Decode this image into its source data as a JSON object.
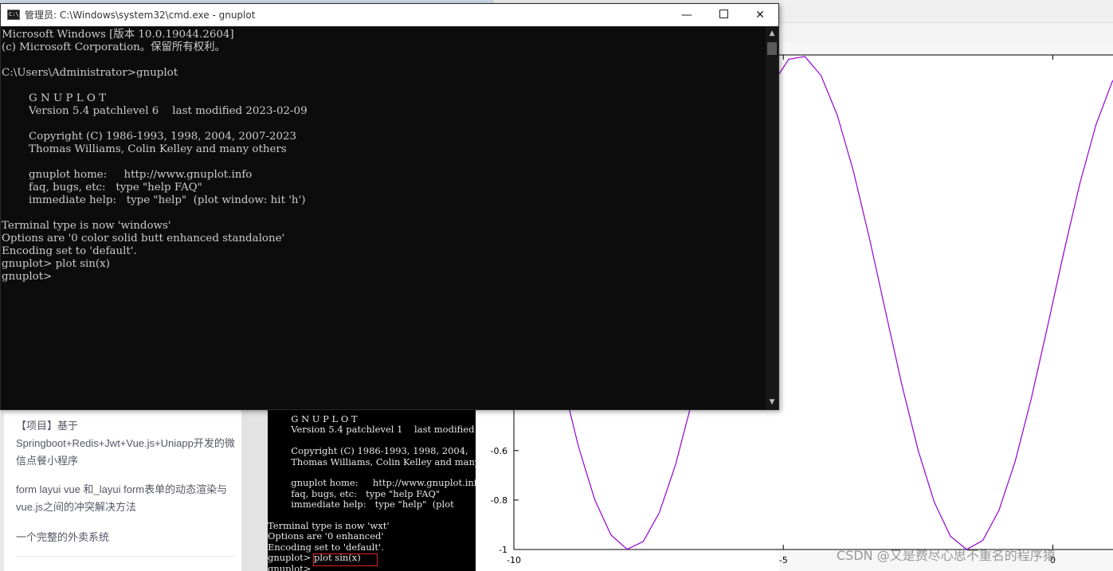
{
  "cmd_window": {
    "title": "管理员: C:\\Windows\\system32\\cmd.exe - gnuplot",
    "icon": "cmd-icon",
    "icon_text": "C:\\",
    "minimize_glyph": "—",
    "close_glyph": "✕",
    "scroll_up_glyph": "▲",
    "scroll_down_glyph": "▼",
    "console_lines": [
      "Microsoft Windows [版本 10.0.19044.2604]",
      "(c) Microsoft Corporation。保留所有权利。",
      "",
      "C:\\Users\\Administrator>gnuplot",
      "",
      "        G N U P L O T",
      "        Version 5.4 patchlevel 6    last modified 2023-02-09",
      "",
      "        Copyright (C) 1986-1993, 1998, 2004, 2007-2023",
      "        Thomas Williams, Colin Kelley and many others",
      "",
      "        gnuplot home:     http://www.gnuplot.info",
      "        faq, bugs, etc:   type \"help FAQ\"",
      "        immediate help:   type \"help\"  (plot window: hit 'h')",
      "",
      "Terminal type is now 'windows'",
      "Options are '0 color solid butt enhanced standalone'",
      "Encoding set to 'default'.",
      "gnuplot> plot sin(x)",
      "gnuplot>"
    ]
  },
  "blog_panel": {
    "items": [
      "【项目】基于Springboot+Redis+Jwt+Vue.js+Uniapp开发的微信点餐小程序",
      "form layui vue 和_layui form表单的动态渲染与vue.js之间的冲突解决方法",
      "一个完整的外卖系统"
    ]
  },
  "embedded_console": {
    "lines": [
      "        G N U P L O T",
      "        Version 5.4 patchlevel 1    last modified",
      "",
      "        Copyright (C) 1986-1993, 1998, 2004,",
      "        Thomas Williams, Colin Kelley and many",
      "",
      "        gnuplot home:     http://www.gnuplot.info",
      "        faq, bugs, etc:   type \"help FAQ\"",
      "        immediate help:   type \"help\"  (plot",
      "",
      "Terminal type is now 'wxt'",
      "Options are '0 enhanced'",
      "Encoding set to 'default'.",
      "gnuplot> plot sin(x)",
      "gnuplot>"
    ]
  },
  "chart_data": {
    "type": "line",
    "function": "sin(x)",
    "series": [
      {
        "values": "sin(x)",
        "color": "#9400d3"
      }
    ],
    "x_ticks": [
      "-10",
      "-5",
      "0"
    ],
    "y_ticks": [
      "-0.6",
      "-0.8",
      "-1"
    ],
    "xlim": [
      -10,
      5
    ],
    "ylim": [
      -1,
      1
    ],
    "grid": false
  },
  "watermark": "CSDN @又是费尽心思不重名的程序猿"
}
